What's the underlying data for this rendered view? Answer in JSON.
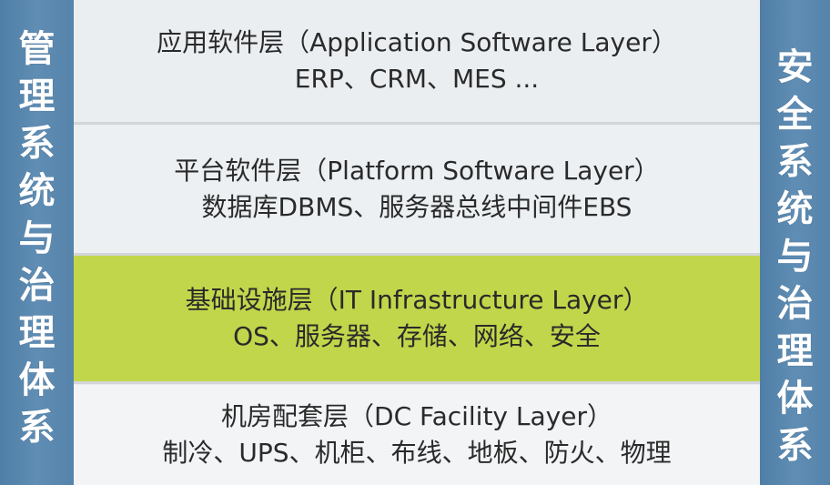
{
  "left_label": [
    "管",
    "理",
    "系",
    "统",
    "与",
    "治",
    "理",
    "体",
    "系"
  ],
  "right_label": [
    "安",
    "全",
    "系",
    "统",
    "与",
    "治",
    "理",
    "体",
    "系"
  ],
  "layers": [
    {
      "title": "应用软件层（Application Software Layer）",
      "desc": "ERP、CRM、MES ..."
    },
    {
      "title": "平台软件层（Platform Software Layer）",
      "desc": "数据库DBMS、服务器总线中间件EBS"
    },
    {
      "title": "基础设施层（IT Infrastructure Layer）",
      "desc": "OS、服务器、存储、网络、安全"
    },
    {
      "title": "机房配套层（DC Facility Layer）",
      "desc": "制冷、UPS、机柜、布线、地板、防火、物理"
    }
  ],
  "colors": {
    "side_panel": "#5683aa",
    "infrastructure_highlight": "#c2d64b",
    "layer_background": "#ebeef1"
  }
}
